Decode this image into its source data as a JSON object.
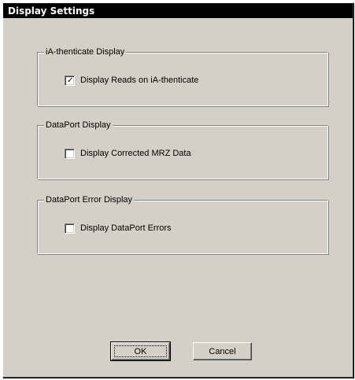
{
  "window": {
    "title": "Display Settings"
  },
  "groups": [
    {
      "legend": "iA-thenticate Display",
      "checkbox_label": "Display Reads on iA-thenticate",
      "checked": true
    },
    {
      "legend": "DataPort  Display",
      "checkbox_label": "Display Corrected MRZ Data",
      "checked": false
    },
    {
      "legend": "DataPort Error Display",
      "checkbox_label": "Display DataPort Errors",
      "checked": false
    }
  ],
  "buttons": {
    "ok_label": "OK",
    "cancel_label": "Cancel"
  }
}
